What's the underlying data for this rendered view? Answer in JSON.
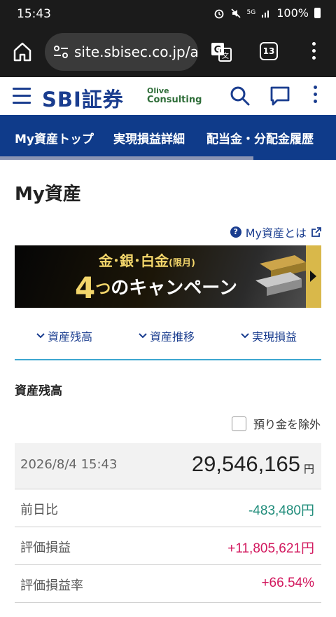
{
  "status_bar": {
    "time": "15:43",
    "network": "5G",
    "battery": "100%"
  },
  "browser": {
    "url": "site.sbisec.co.jp/a",
    "tab_count": "13"
  },
  "site_header": {
    "logo": "SBI証券",
    "partner_line1": "Olive",
    "partner_line2": "Consulting"
  },
  "nav": {
    "tabs": [
      {
        "label": "My資産トップ"
      },
      {
        "label": "実現損益詳細"
      },
      {
        "label": "配当金・分配金履歴"
      }
    ]
  },
  "page": {
    "title": "My資産",
    "about_link": "My資産とは"
  },
  "banner": {
    "top_text": "金･銀･白金",
    "top_note": "(限月)",
    "number": "4",
    "tsu": "つ",
    "main_text": "のキャンペーン"
  },
  "anchors": [
    {
      "label": "資産残高"
    },
    {
      "label": "資産推移"
    },
    {
      "label": "実現損益"
    }
  ],
  "balance": {
    "section_title": "資産残高",
    "exclude_label": "預り金を除外",
    "exclude_checked": false,
    "datetime": "2026/8/4 15:43",
    "total": "29,546,165",
    "currency": "円",
    "rows": [
      {
        "label": "前日比",
        "value": "-483,480円",
        "color": "#1f8c7a"
      },
      {
        "label": "評価損益",
        "value": "+11,805,621円",
        "color": "#d2185e"
      },
      {
        "label": "評価損益率",
        "value": "+66.54%",
        "color": "#d2185e"
      }
    ]
  }
}
